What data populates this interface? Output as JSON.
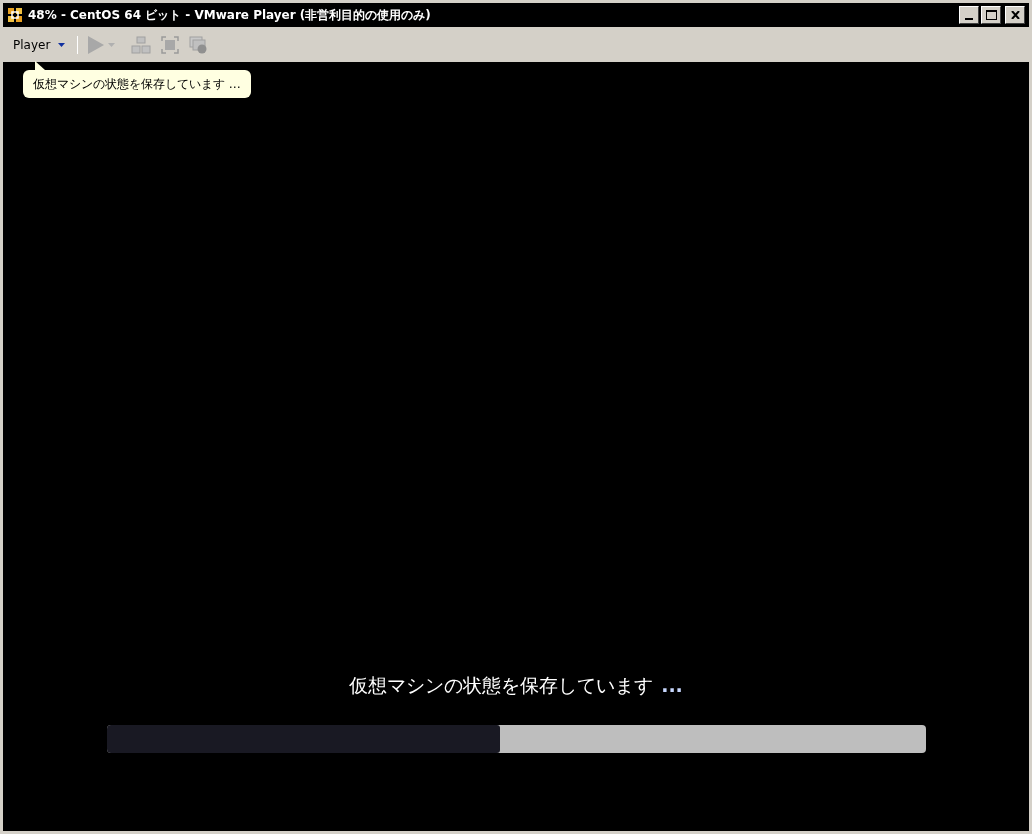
{
  "window": {
    "title": "48% - CentOS 64 ビット - VMware Player (非営利目的の使用のみ)"
  },
  "toolbar": {
    "menu_label": "Player"
  },
  "tooltip": {
    "text": "仮想マシンの状態を保存しています …"
  },
  "status": {
    "message": "仮想マシンの状態を保存しています",
    "ellipsis": "..."
  },
  "progress": {
    "level": 0.48
  }
}
